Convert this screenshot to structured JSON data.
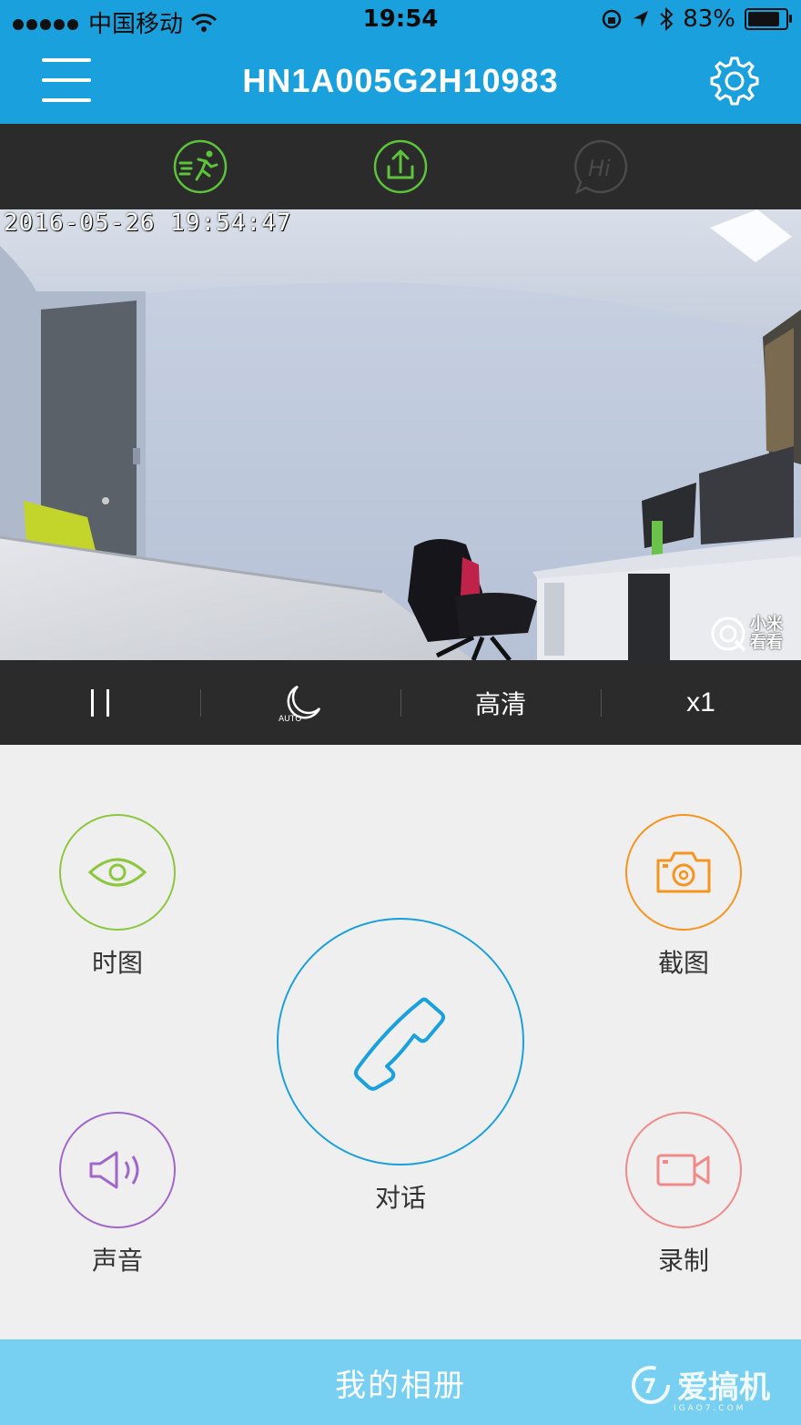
{
  "status_bar": {
    "carrier": "中国移动",
    "time": "19:54",
    "battery": "83%",
    "icons": [
      "signal-dots-icon",
      "wifi-icon",
      "orientation-lock-icon",
      "location-icon",
      "bluetooth-icon",
      "battery-icon"
    ]
  },
  "header": {
    "title": "HN1A005G2H10983",
    "icons": [
      "menu-icon",
      "gear-icon"
    ],
    "color": "#1aa1dd"
  },
  "feature_bar": {
    "items": [
      {
        "icon": "motion-detect-icon",
        "active": true
      },
      {
        "icon": "share-upload-icon",
        "active": true
      },
      {
        "icon": "hi-greeting-icon",
        "active": false
      }
    ],
    "active_color": "#5cc43a"
  },
  "video": {
    "timestamp": "2016-05-26 19:54:47",
    "watermark_line1": "小米",
    "watermark_line2": "看看"
  },
  "controls": {
    "pause_icon": "pause-icon",
    "night_mode_badge": "AUTO",
    "quality_label": "高清",
    "zoom_label": "x1"
  },
  "actions": {
    "live_view": {
      "label": "时图",
      "icon": "eye-icon",
      "color": "#8dc63f"
    },
    "screenshot": {
      "label": "截图",
      "icon": "camera-icon",
      "color": "#f7941d"
    },
    "talk": {
      "label": "对话",
      "icon": "phone-icon",
      "color": "#1aa1dd"
    },
    "sound": {
      "label": "声音",
      "icon": "speaker-icon",
      "color": "#a066cc"
    },
    "record": {
      "label": "录制",
      "icon": "video-camera-icon",
      "color": "#f08a8a"
    }
  },
  "album": {
    "label": "我的相册",
    "brand_text": "爱搞机",
    "brand_sub": "IGAO7.COM"
  }
}
